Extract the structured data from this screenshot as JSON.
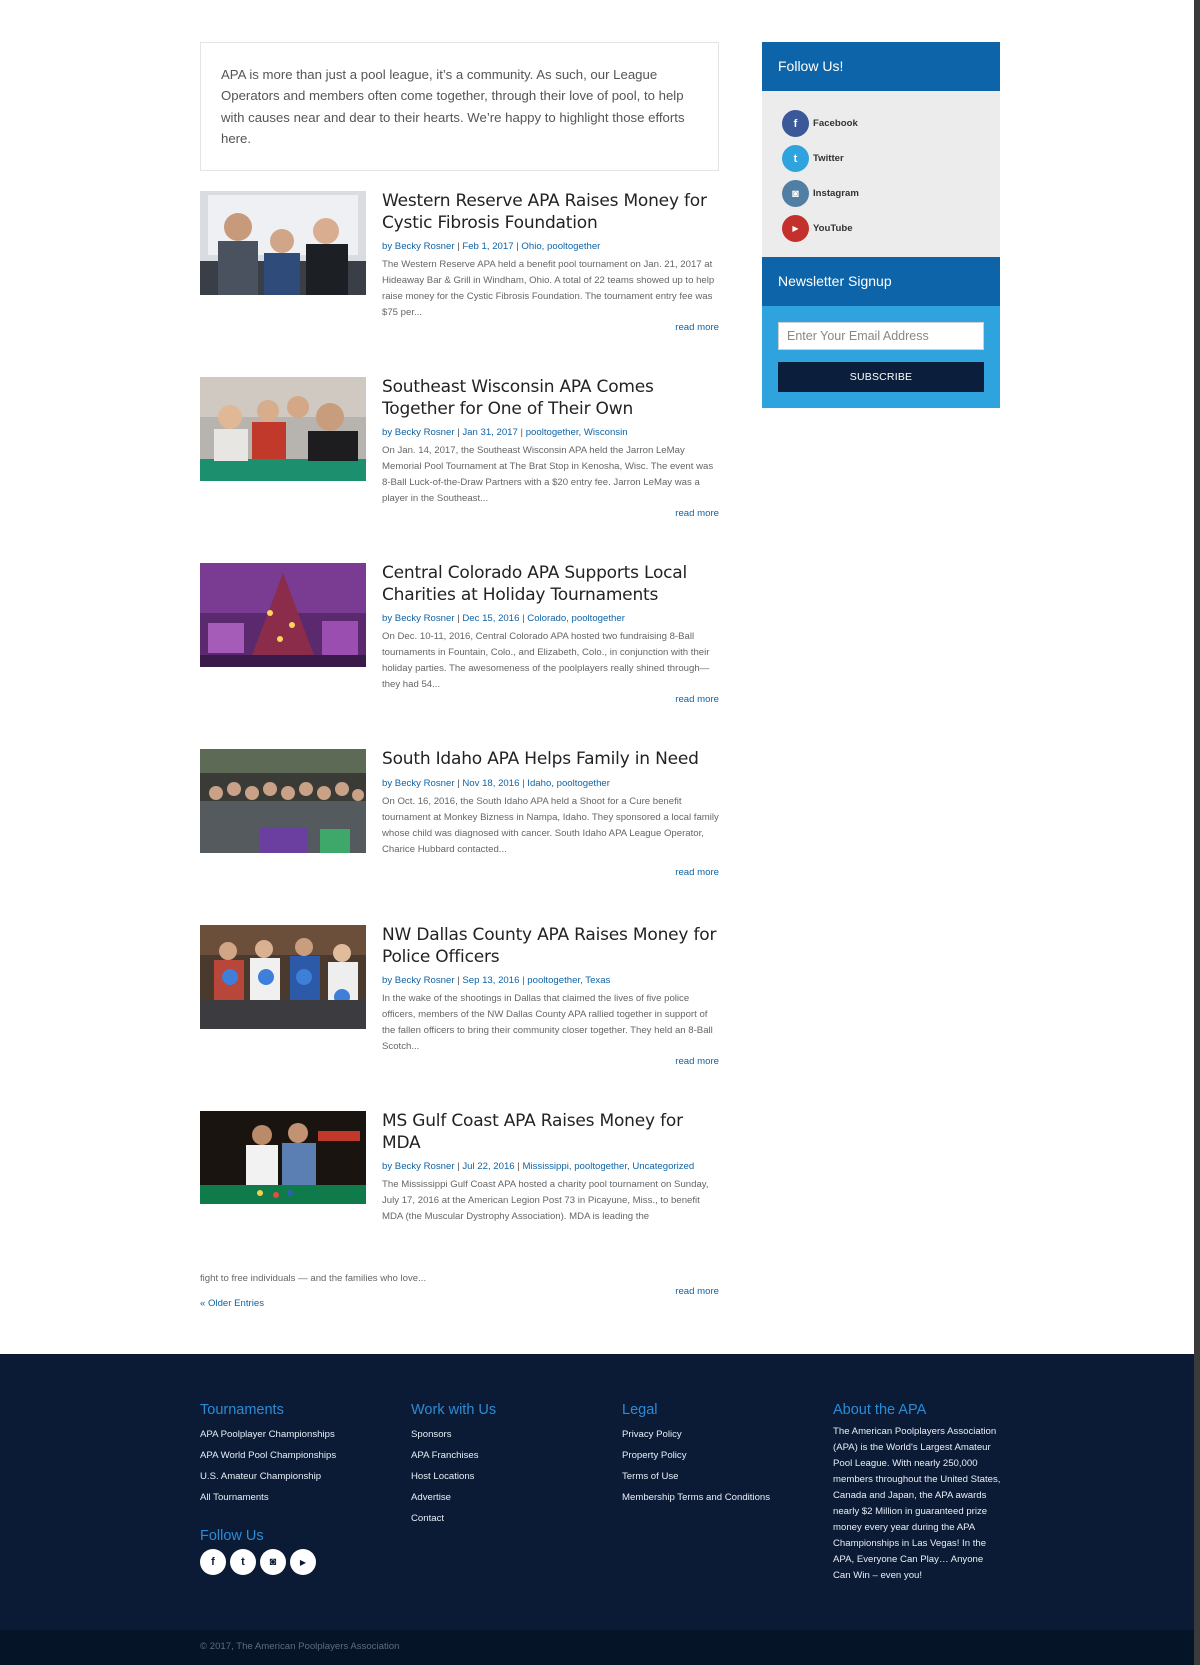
{
  "intro": {
    "text": "APA is more than just a pool league, it’s a community. As such, our League Operators and members often come together, through their love of pool, to help with causes near and dear to their hearts. We’re happy to highlight those efforts here."
  },
  "posts": [
    {
      "title": "Western Reserve APA Raises Money for Cystic Fibrosis Foundation",
      "by": "by Becky Rosner",
      "date": "Feb 1, 2017",
      "categories": "Ohio, pooltogether",
      "excerpt": "The Western Reserve APA held a benefit pool tournament on Jan. 21, 2017 at Hideaway Bar & Grill in Windham, Ohio. A total of 22 teams showed up to help raise money for the Cystic Fibrosis Foundation. The tournament entry fee was $75 per...",
      "read_more": "read more"
    },
    {
      "title": "Southeast Wisconsin APA Comes Together for One of Their Own",
      "by": "by Becky Rosner",
      "date": "Jan 31, 2017",
      "categories": "pooltogether, Wisconsin",
      "excerpt": "On Jan. 14, 2017, the Southeast Wisconsin APA held the Jarron LeMay Memorial Pool Tournament at The Brat Stop in Kenosha, Wisc. The event was 8-Ball Luck-of-the-Draw Partners with a $20 entry fee. Jarron LeMay was a player in the Southeast...",
      "read_more": "read more"
    },
    {
      "title": "Central Colorado APA Supports Local Charities at Holiday Tournaments",
      "by": "by Becky Rosner",
      "date": "Dec 15, 2016",
      "categories": "Colorado, pooltogether",
      "excerpt": "On Dec. 10-11, 2016, Central Colorado APA hosted two fundraising 8-Ball tournaments in Fountain, Colo., and Elizabeth, Colo., in conjunction with their holiday parties.  The awesomeness of the  poolplayers really shined through—they had 54...",
      "read_more": "read more"
    },
    {
      "title": "South Idaho APA Helps Family in Need",
      "by": "by Becky Rosner",
      "date": "Nov 18, 2016",
      "categories": "Idaho, pooltogether",
      "excerpt": "On Oct. 16, 2016, the South Idaho APA held a Shoot for a Cure benefit tournament at Monkey Bizness in Nampa, Idaho. They sponsored a local family whose child was diagnosed with cancer. South Idaho APA League Operator, Charice Hubbard contacted...",
      "read_more": "read more"
    },
    {
      "title": "NW Dallas County APA Raises Money for Police Officers",
      "by": "by Becky Rosner",
      "date": "Sep 13, 2016",
      "categories": "pooltogether, Texas",
      "excerpt": "In the wake of the shootings in Dallas that claimed the lives of five police officers, members of the NW Dallas County APA rallied together in support of the fallen officers to bring their community closer together. They held an 8-Ball Scotch...",
      "read_more": "read more"
    },
    {
      "title": "MS Gulf Coast APA Raises Money for MDA",
      "by": "by Becky Rosner",
      "date": "Jul 22, 2016",
      "categories": "Mississippi, pooltogether, Uncategorized",
      "excerpt": "The Mississippi Gulf Coast APA hosted a charity pool tournament on Sunday, July 17, 2016 at the American Legion Post 73 in Picayune, Miss., to benefit MDA (the Muscular Dystrophy Association). MDA is leading the",
      "excerpt_tail": "fight to free individuals — and the families who love...",
      "read_more": "read more"
    }
  ],
  "older_entries": "« Older Entries",
  "sidebar": {
    "follow_title": "Follow Us!",
    "social": [
      {
        "name": "Facebook",
        "icon": "facebook-icon",
        "color": "#3b5998",
        "glyph": "f"
      },
      {
        "name": "Twitter",
        "icon": "twitter-icon",
        "color": "#2ea3dd",
        "glyph": "t"
      },
      {
        "name": "Instagram",
        "icon": "instagram-icon",
        "color": "#517fa4",
        "glyph": "◙"
      },
      {
        "name": "YouTube",
        "icon": "youtube-icon",
        "color": "#c4302b",
        "glyph": "▶"
      }
    ],
    "newsletter_title": "Newsletter Signup",
    "email_placeholder": "Enter Your Email Address",
    "subscribe_label": "SUBSCRIBE"
  },
  "footer": {
    "tournaments": {
      "title": "Tournaments",
      "links": [
        "APA Poolplayer Championships",
        "APA World Pool Championships",
        "U.S. Amateur Championship",
        "All Tournaments"
      ]
    },
    "work": {
      "title": "Work with Us",
      "links": [
        "Sponsors",
        "APA Franchises",
        "Host Locations",
        "Advertise",
        "Contact"
      ]
    },
    "legal": {
      "title": "Legal",
      "links": [
        "Privacy Policy",
        "Property Policy",
        "Terms of Use",
        "Membership Terms and Conditions"
      ]
    },
    "about": {
      "title": "About the APA",
      "text": "The American Poolplayers Association (APA) is the World's Largest Amateur Pool League. With nearly 250,000 members throughout the United States, Canada and Japan, the APA awards nearly $2 Million in guaranteed prize money every year during the APA Championships in Las Vegas! In the APA, Everyone Can Play… Anyone Can Win – even you!"
    },
    "follow_title": "Follow Us",
    "follow_icons": [
      "facebook-icon",
      "twitter-icon",
      "instagram-icon",
      "youtube-icon"
    ],
    "copyright": "© 2017, The American Poolplayers Association"
  },
  "colors": {
    "link": "#0e64a8",
    "widget_header": "#0e64a8",
    "newsletter_bg": "#2ea3dd",
    "footer_bg": "#0b1b36",
    "footer_heading": "#2c8bd6"
  }
}
